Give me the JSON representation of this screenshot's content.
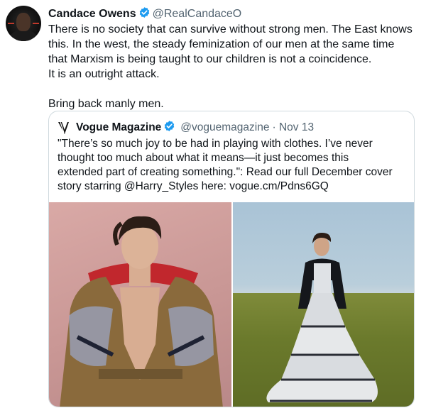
{
  "tweet": {
    "author_name": "Candace Owens",
    "author_handle": "@RealCandaceO",
    "lines": [
      "There is no society that can survive without strong men. The East knows",
      "this. In the west, the steady feminization of our men at the same time",
      "that Marxism is being taught to our children is not a coincidence.",
      "It is an outright attack."
    ],
    "closing": "Bring back manly men."
  },
  "quote": {
    "author_name": "Vogue Magazine",
    "author_handle": "@voguemagazine",
    "date": "· Nov 13",
    "lines": [
      "\"There’s so much joy to be had in playing with clothes. I’ve never",
      "thought too much about what it means—it just becomes this",
      "extended part of creating something.\": Read our full December cover",
      "story starring @Harry_Styles here: vogue.cm/Pdns6GQ"
    ]
  },
  "colors": {
    "verified": "#1d9bf0",
    "secondary_text": "#536471",
    "border": "#cfd9de"
  },
  "icons": [
    "verified-badge-icon",
    "vogue-logo-icon"
  ]
}
